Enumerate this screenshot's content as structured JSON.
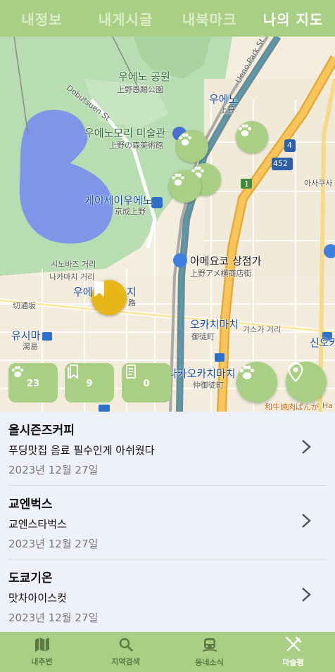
{
  "top_tabs": [
    {
      "label": "내정보"
    },
    {
      "label": "내게시글"
    },
    {
      "label": "내북마크"
    },
    {
      "label": "나의 지도"
    }
  ],
  "map": {
    "labels": {
      "ueno_park_ko": "우에노 공원",
      "ueno_park_ja": "上野恩賜公園",
      "ueno_forest_ko": "우에노모리 미술관",
      "ueno_forest_ja": "上野の森美術館",
      "keisei_ueno_ko": "게이세이우에노",
      "keisei_ueno_ja": "京成上野",
      "ueno_station_ko": "우에노",
      "ueno_station_ja": "上野",
      "ameyoko_ko": "아메요코 상점가",
      "ameyoko_ja": "上野アメ横商店街",
      "okachimachi_ko": "오카치마치",
      "okachimachi_ja": "御徒町",
      "nakaokachimachi_ko": "나카오카치마치",
      "nakaokachimachi_ja": "仲御徒町",
      "yushima_ko": "유시마",
      "yushima_ja": "湯島",
      "shinokachimachi": "신오카",
      "ueno_hirokoji": "우에노",
      "ueno_hirokoji_tail": "지",
      "hirokoji_ja": "路",
      "shinobazu": "시노바즈 거리",
      "nakamachi": "나카마치 거리",
      "kasuga": "가스가 거리",
      "asakusa": "아사쿠사",
      "kiritoshi": "切通坂",
      "dobutsuen": "Dobutsuen St",
      "ueno_park_st": "Ueno Park St",
      "route_452": "452",
      "route_4": "4",
      "route_1": "1",
      "wagyu": "和牛焼肉ぱんが",
      "ha": "Ha"
    },
    "counters": [
      {
        "icon": "paw-icon",
        "value": "23"
      },
      {
        "icon": "bookmark-icon",
        "value": "9"
      },
      {
        "icon": "document-icon",
        "value": "0"
      }
    ]
  },
  "list": [
    {
      "title": "올시즌즈커피",
      "subtitle": "푸딩맛집 음료 필수인게 아쉬웠다",
      "date": "2023년 12월 27일"
    },
    {
      "title": "교엔벅스",
      "subtitle": "교엔스타벅스",
      "date": "2023년 12월 27일"
    },
    {
      "title": "도쿄기온",
      "subtitle": "맛차아이스컷",
      "date": "2023년 12월 27일"
    }
  ],
  "bottom_nav": [
    {
      "icon": "map-icon",
      "label": "내주변"
    },
    {
      "icon": "search-icon",
      "label": "지역검색"
    },
    {
      "icon": "bus-icon",
      "label": "동네소식"
    },
    {
      "icon": "utensils-icon",
      "label": "마슐랭"
    }
  ],
  "colors": {
    "accent": "#a8cf83",
    "bookmark_pin": "#e8b619",
    "list_bg": "#eef1fa"
  }
}
